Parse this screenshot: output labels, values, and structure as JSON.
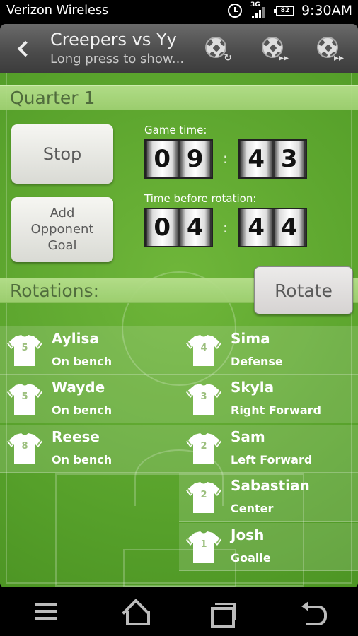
{
  "status_bar": {
    "carrier": "Verizon Wireless",
    "network": "3G",
    "battery": "82",
    "time": "9:30AM"
  },
  "action_bar": {
    "title": "Creepers vs Yy",
    "subtitle": "Long press to show...",
    "actions": [
      {
        "name": "ball-refresh-icon",
        "badge": "↻"
      },
      {
        "name": "ball-forward-icon",
        "badge": "▸▸"
      },
      {
        "name": "ball-fast-forward-icon",
        "badge": "▸▸"
      }
    ]
  },
  "quarter": {
    "label": "Quarter 1"
  },
  "controls": {
    "stop_label": "Stop",
    "goal_label_lines": [
      "Add",
      "Opponent",
      "Goal"
    ],
    "rotate_label": "Rotate"
  },
  "game_time": {
    "label": "Game time:",
    "digits": [
      "0",
      "9",
      "4",
      "3"
    ],
    "separator": ":"
  },
  "rotation_time": {
    "label": "Time before rotation:",
    "digits": [
      "0",
      "4",
      "4",
      "4"
    ],
    "separator": ":"
  },
  "rotations": {
    "label": "Rotations:",
    "bench": [
      {
        "number": "5",
        "name": "Aylisa",
        "position": "On bench"
      },
      {
        "number": "5",
        "name": "Wayde",
        "position": "On bench"
      },
      {
        "number": "8",
        "name": "Reese",
        "position": "On bench"
      }
    ],
    "field": [
      {
        "number": "4",
        "name": "Sima",
        "position": "Defense"
      },
      {
        "number": "3",
        "name": "Skyla",
        "position": "Right Forward"
      },
      {
        "number": "2",
        "name": "Sam",
        "position": "Left Forward"
      },
      {
        "number": "2",
        "name": "Sabastian",
        "position": "Center"
      },
      {
        "number": "1",
        "name": "Josh",
        "position": "Goalie"
      }
    ]
  },
  "colors": {
    "field_green": "#56a02a",
    "header_green": "#a8d67c",
    "header_text": "#506a3e",
    "action_bar": "#4a4a4a"
  }
}
